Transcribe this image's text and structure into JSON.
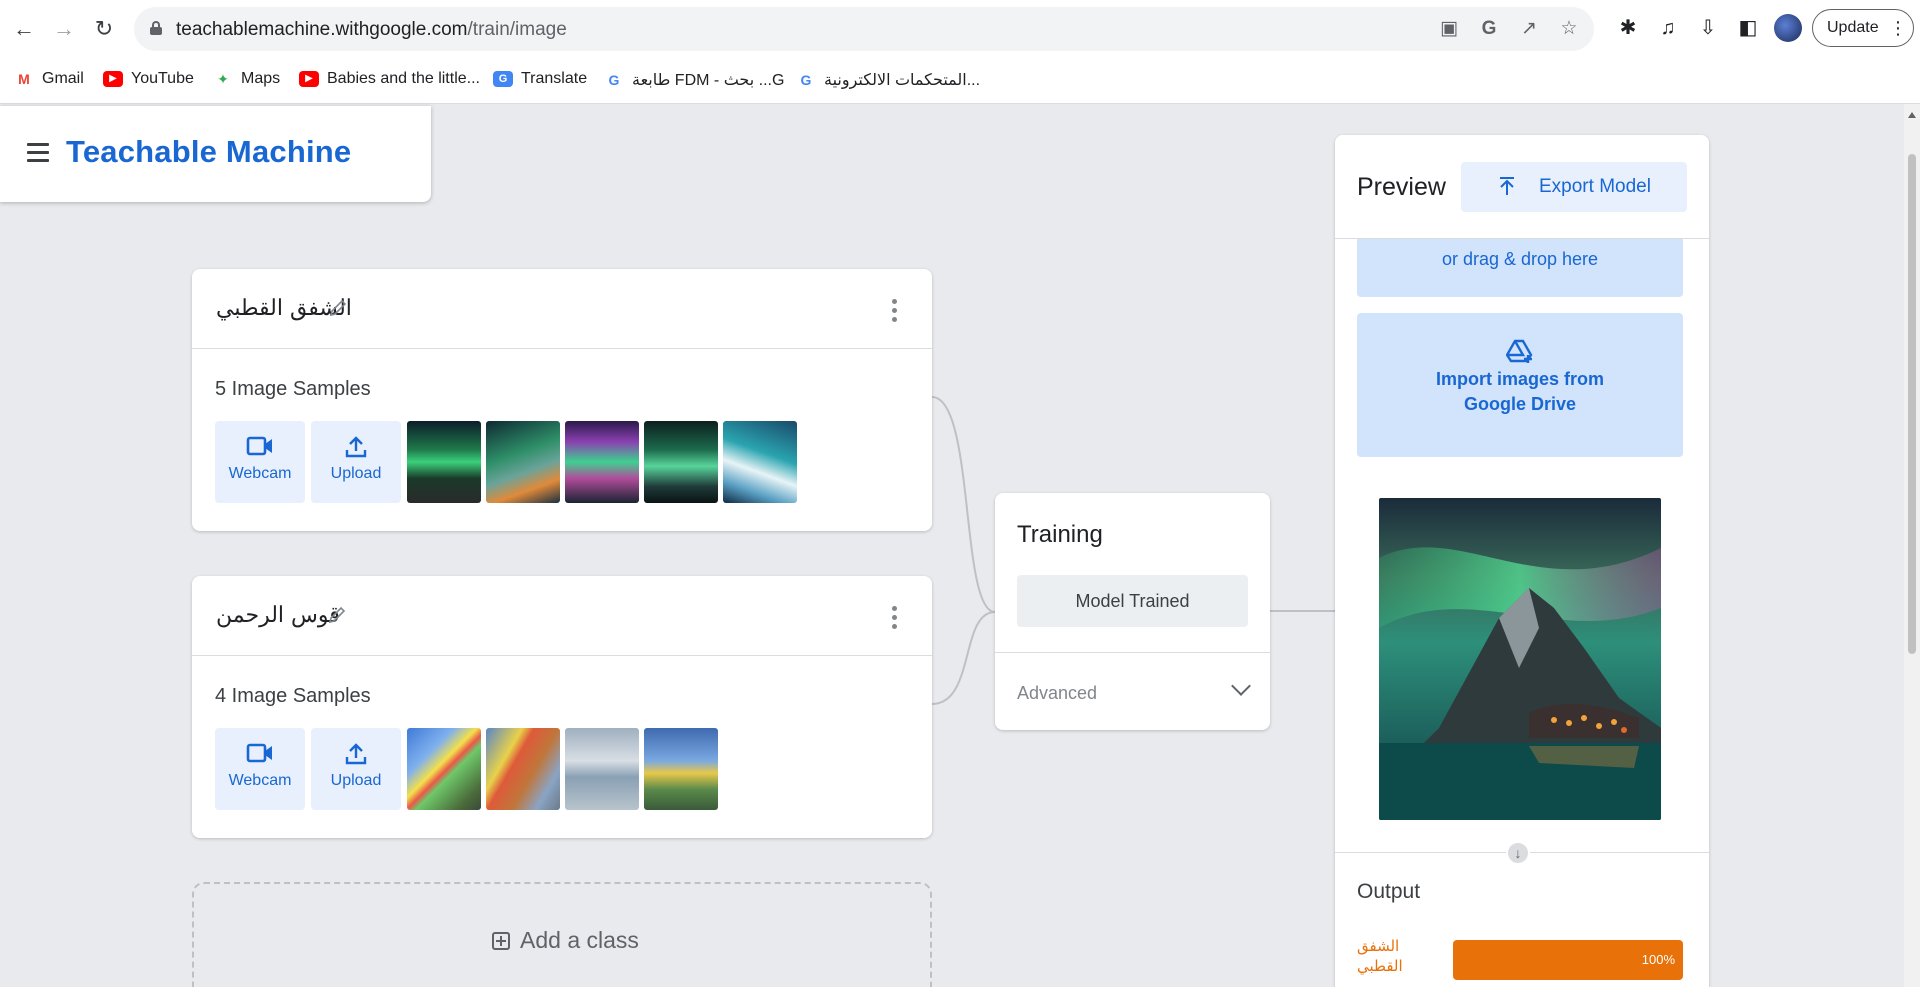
{
  "browser": {
    "url_domain": "teachablemachine.withgoogle.com",
    "url_path": "/train/image",
    "update_label": "Update",
    "bookmarks": [
      {
        "label": "Gmail",
        "icon": "gmail-icon"
      },
      {
        "label": "YouTube",
        "icon": "youtube-icon"
      },
      {
        "label": "Maps",
        "icon": "maps-icon"
      },
      {
        "label": "Babies and the little...",
        "icon": "youtube-icon"
      },
      {
        "label": "Translate",
        "icon": "translate-icon"
      },
      {
        "label": "طابعة FDM - بحث ...G",
        "icon": "google-icon"
      },
      {
        "label": "المتحكمات الالكترونية...",
        "icon": "google-icon"
      }
    ]
  },
  "app": {
    "title": "Teachable Machine"
  },
  "classes": [
    {
      "name": "الشفق القطبي",
      "samples_label": "5 Image Samples",
      "webcam_label": "Webcam",
      "upload_label": "Upload",
      "thumbnails": [
        "aurora-forest",
        "aurora-lake",
        "aurora-purple",
        "aurora-shore",
        "aurora-icy"
      ]
    },
    {
      "name": "قوس الرحمن",
      "samples_label": "4 Image Samples",
      "webcam_label": "Webcam",
      "upload_label": "Upload",
      "thumbnails": [
        "rainbow-sky",
        "rainbow-tree",
        "rainbow-lake",
        "rainbow-village"
      ]
    }
  ],
  "add_class_label": "Add a class",
  "training": {
    "title": "Training",
    "status_button": "Model Trained",
    "advanced_label": "Advanced"
  },
  "preview": {
    "title": "Preview",
    "export_label": "Export Model",
    "drag_text": "or drag & drop here",
    "drive_line1": "Import images from",
    "drive_line2": "Google Drive",
    "image": "aurora-mountain-village",
    "output_title": "Output",
    "output_label": "الشفق القطبي",
    "output_percent": "100%",
    "output_value": 1.0
  },
  "colors": {
    "brand_blue": "#1967d2",
    "output_orange": "#e8710a"
  }
}
